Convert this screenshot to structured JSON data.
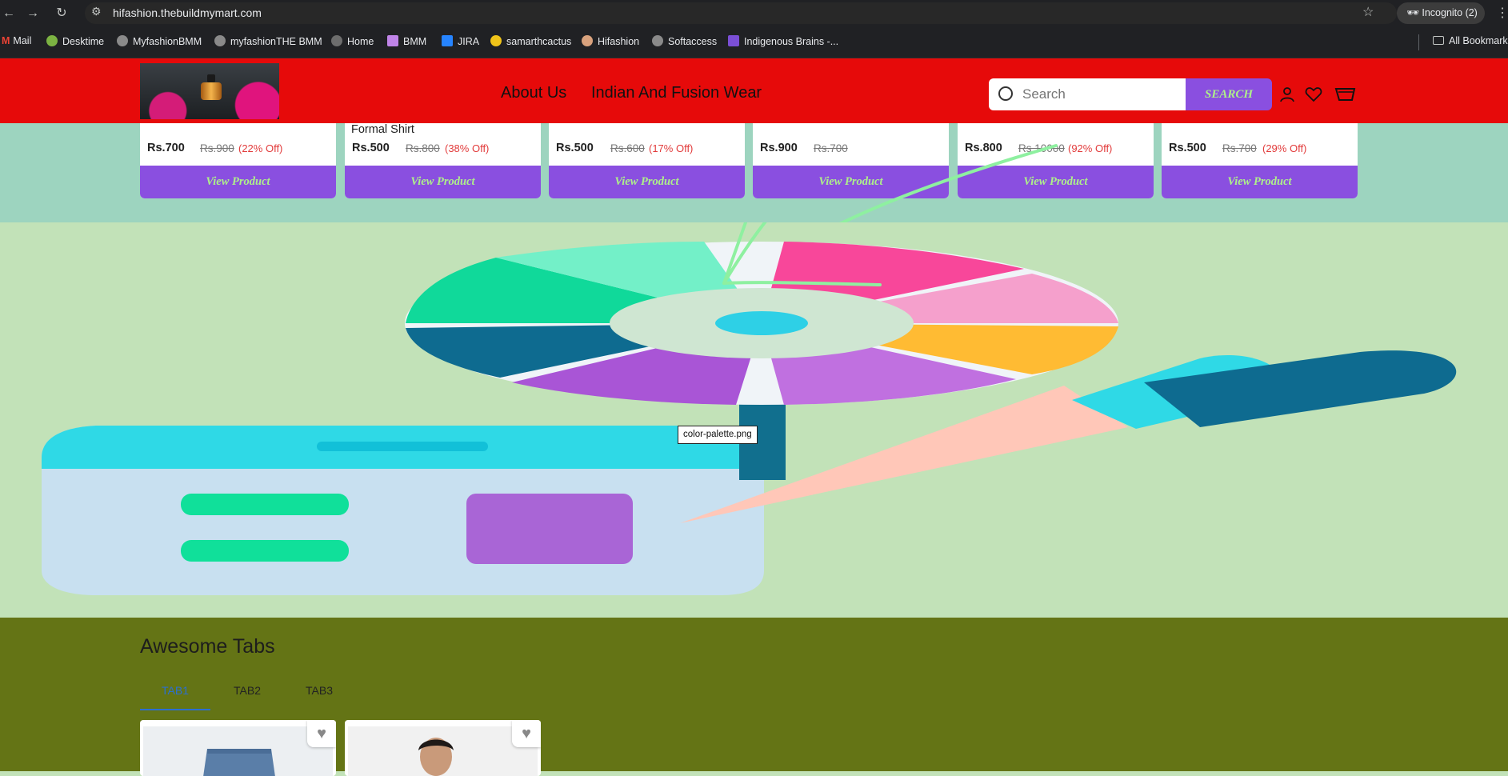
{
  "browser": {
    "url": "hifashion.thebuildmymart.com",
    "incognito_label": "Incognito (2)",
    "bookmarks": [
      "Mail",
      "Desktime",
      "MyfashionBMM",
      "myfashionTHE BMM",
      "Home",
      "BMM",
      "JIRA",
      "samarthcactus",
      "Hifashion",
      "Softaccess",
      "Indigenous Brains -...",
      "All Bookmarks"
    ]
  },
  "header": {
    "nav": [
      "About Us",
      "Indian And Fusion Wear"
    ],
    "search_placeholder": "Search",
    "search_button": "SEARCH",
    "colors": {
      "header_bg": "#e60a0a",
      "button_bg": "#8a4fe0",
      "button_text": "#aef08a"
    }
  },
  "products": [
    {
      "name": "",
      "price": "Rs.700",
      "mrp": "Rs.900",
      "off": "(22% Off)",
      "button": "View Product"
    },
    {
      "name": "Formal Shirt",
      "price": "Rs.500",
      "mrp": "Rs.800",
      "off": "(38% Off)",
      "button": "View Product"
    },
    {
      "name": "",
      "price": "Rs.500",
      "mrp": "Rs.600",
      "off": "(17% Off)",
      "button": "View Product"
    },
    {
      "name": "",
      "price": "Rs.900",
      "mrp": "Rs.700",
      "off": "",
      "button": "View Product"
    },
    {
      "name": "",
      "price": "Rs.800",
      "mrp": "Rs.10000",
      "off": "(92% Off)",
      "button": "View Product"
    },
    {
      "name": "",
      "price": "Rs.500",
      "mrp": "Rs.700",
      "off": "(29% Off)",
      "button": "View Product"
    }
  ],
  "hero": {
    "tooltip": "color-palette.png"
  },
  "tabs_section": {
    "title": "Awesome Tabs",
    "tabs": [
      "TAB1",
      "TAB2",
      "TAB3"
    ],
    "active_tab": "TAB1"
  },
  "icons": [
    "back-icon",
    "forward-icon",
    "reload-icon",
    "site-settings-icon",
    "bookmark-star-icon",
    "incognito-icon",
    "menu-icon",
    "folder-icon",
    "search-icon",
    "user-icon",
    "wishlist-heart-icon",
    "cart-icon",
    "favorite-heart-icon"
  ]
}
